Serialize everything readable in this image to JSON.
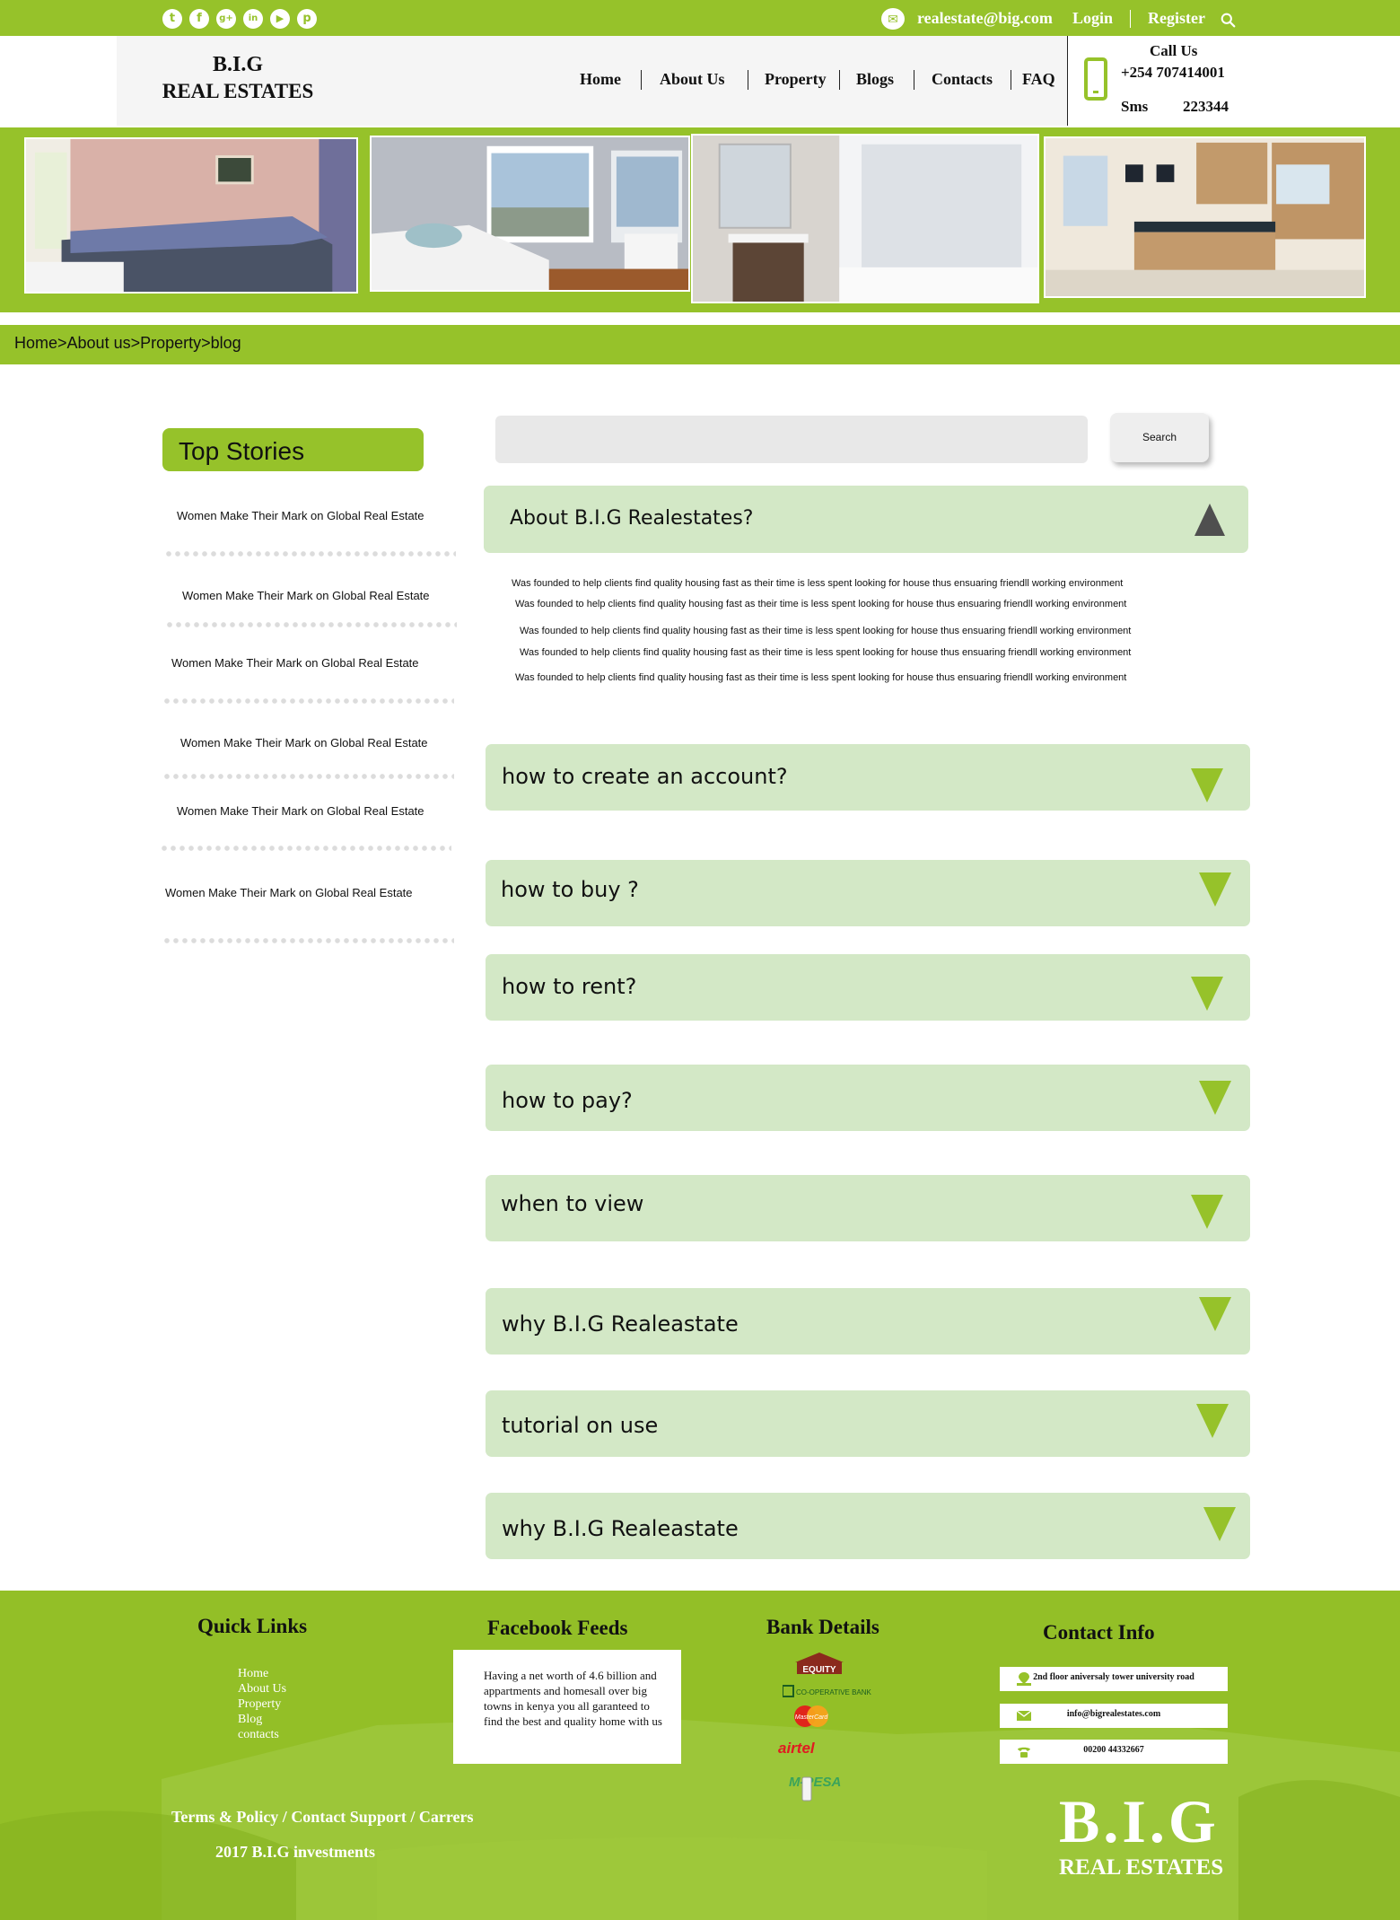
{
  "topbar": {
    "social": [
      "twitter-icon",
      "facebook-icon",
      "google-plus-icon",
      "linkedin-icon",
      "youtube-icon",
      "pinterest-icon"
    ],
    "email": "realestate@big.com",
    "login": "Login",
    "register": "Register"
  },
  "logo": {
    "line1": "B.I.G",
    "line2": "REAL ESTATES"
  },
  "nav": [
    "Home",
    "About Us",
    "Property",
    "Blogs",
    "Contacts",
    "FAQ"
  ],
  "contact": {
    "call_label": "Call Us",
    "phone": "+254 707414001",
    "sms_label": "Sms",
    "sms_number": "223344"
  },
  "breadcrumb": "Home>About us>Property>blog",
  "sidebar": {
    "title": "Top Stories",
    "stories": [
      "Women Make Their Mark on Global Real Estate",
      "Women Make Their Mark on Global Real Estate",
      "Women Make Their Mark on Global Real Estate",
      "Women Make Their Mark on Global Real Estate",
      "Women Make Their Mark on Global Real Estate",
      "Women Make Their Mark on Global Real Estate"
    ]
  },
  "search": {
    "button": "Search",
    "placeholder": ""
  },
  "faq": {
    "open_title": "About B.I.G Realestates?",
    "open_lines": [
      "Was founded to help clients find quality housing fast as their time is less spent looking for house thus ensuaring friendll working environment",
      "Was founded to help clients find quality housing fast as their time is less spent looking for house thus ensuaring friendll working environment",
      "Was founded to help clients find quality housing fast as their time is less spent looking for house thus ensuaring friendll working environment",
      "Was founded to help clients find quality housing fast as their time is less spent looking for house thus ensuaring friendll working environment",
      "Was founded to help clients find quality housing fast as their time is less spent looking for house thus ensuaring friendll working environment"
    ],
    "items": [
      "how to create an account?",
      "how to buy ?",
      "how to rent?",
      "how to pay?",
      "when to view",
      "why B.I.G Realeastate",
      "tutorial on use",
      "why B.I.G Realeastate"
    ]
  },
  "footer": {
    "quick_links_title": "Quick Links",
    "quick_links": [
      "Home",
      "About Us",
      "Property",
      "Blog",
      "contacts"
    ],
    "facebook_title": "Facebook Feeds",
    "facebook_text": "Having a net worth of 4.6 billion and appartments and homesall over big towns in kenya you all garanteed to find the best and quality home with us",
    "bank_title": "Bank Details",
    "banks": [
      "EQUITY",
      "CO-OPERATIVE BANK",
      "MasterCard",
      "airtel",
      "M-PESA"
    ],
    "contact_title": "Contact Info",
    "contact_items": [
      "2nd floor aniversaly tower university road",
      "info@bigrealestates.com",
      "00200 44332667"
    ],
    "bottom_links": "Terms & Policy / Contact Support / Carrers",
    "copyright": "2017 B.I.G investments",
    "logo_big": "B.I.G",
    "logo_small": "REAL ESTATES"
  },
  "colors": {
    "accent": "#96c22a",
    "accordion_bg": "#d3e8c6",
    "header_bg": "#f5f5f5"
  }
}
